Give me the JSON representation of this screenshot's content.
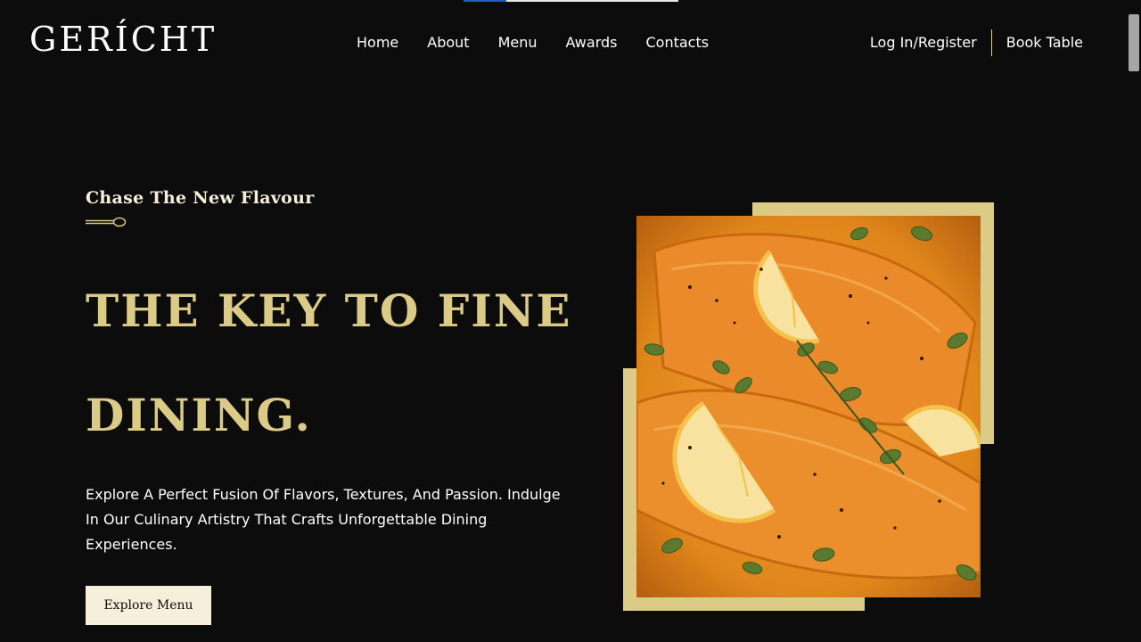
{
  "brand": {
    "logo": "GERÍCHT"
  },
  "nav": {
    "links": [
      "Home",
      "About",
      "Menu",
      "Awards",
      "Contacts"
    ],
    "login": "Log In/Register",
    "book": "Book Table"
  },
  "hero": {
    "subtitle": "Chase The New Flavour",
    "headline_line1": "THE KEY TO FINE",
    "headline_line2": "DINING.",
    "description": "Explore A Perfect Fusion Of Flavors, Textures, And Passion. Indulge In Our Culinary Artistry That Crafts Unforgettable Dining Experiences.",
    "cta": "Explore Menu"
  },
  "colors": {
    "gold": "#dcca87",
    "background": "#0c0c0c",
    "crimson": "#f5efdb",
    "sauce": "#e48a1c"
  },
  "icons": {
    "spoon": "spoon-icon"
  }
}
